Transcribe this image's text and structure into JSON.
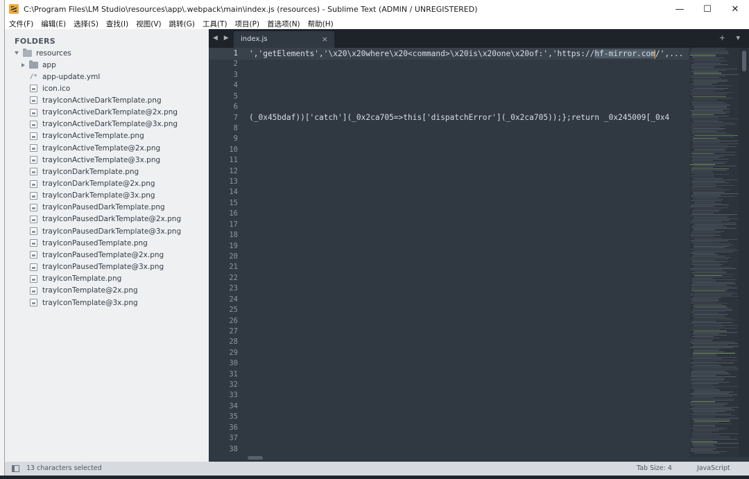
{
  "window": {
    "title": "C:\\Program Files\\LM Studio\\resources\\app\\.webpack\\main\\index.js (resources) - Sublime Text (ADMIN / UNREGISTERED)",
    "controls": {
      "minimize": "—",
      "maximize": "☐",
      "close": "✕"
    }
  },
  "menu": [
    "文件(F)",
    "编辑(E)",
    "选择(S)",
    "查找(I)",
    "视图(V)",
    "跳转(G)",
    "工具(T)",
    "项目(P)",
    "首选项(N)",
    "帮助(H)"
  ],
  "sidebar": {
    "header": "FOLDERS",
    "root": "resources",
    "items": [
      {
        "name": "app",
        "kind": "folder"
      },
      {
        "name": "app-update.yml",
        "kind": "code"
      },
      {
        "name": "icon.ico",
        "kind": "image"
      },
      {
        "name": "trayIconActiveDarkTemplate.png",
        "kind": "image"
      },
      {
        "name": "trayIconActiveDarkTemplate@2x.png",
        "kind": "image"
      },
      {
        "name": "trayIconActiveDarkTemplate@3x.png",
        "kind": "image"
      },
      {
        "name": "trayIconActiveTemplate.png",
        "kind": "image"
      },
      {
        "name": "trayIconActiveTemplate@2x.png",
        "kind": "image"
      },
      {
        "name": "trayIconActiveTemplate@3x.png",
        "kind": "image"
      },
      {
        "name": "trayIconDarkTemplate.png",
        "kind": "image"
      },
      {
        "name": "trayIconDarkTemplate@2x.png",
        "kind": "image"
      },
      {
        "name": "trayIconDarkTemplate@3x.png",
        "kind": "image"
      },
      {
        "name": "trayIconPausedDarkTemplate.png",
        "kind": "image"
      },
      {
        "name": "trayIconPausedDarkTemplate@2x.png",
        "kind": "image"
      },
      {
        "name": "trayIconPausedDarkTemplate@3x.png",
        "kind": "image"
      },
      {
        "name": "trayIconPausedTemplate.png",
        "kind": "image"
      },
      {
        "name": "trayIconPausedTemplate@2x.png",
        "kind": "image"
      },
      {
        "name": "trayIconPausedTemplate@3x.png",
        "kind": "image"
      },
      {
        "name": "trayIconTemplate.png",
        "kind": "image"
      },
      {
        "name": "trayIconTemplate@2x.png",
        "kind": "image"
      },
      {
        "name": "trayIconTemplate@3x.png",
        "kind": "image"
      }
    ]
  },
  "editor": {
    "tab": {
      "label": "index.js",
      "close": "×"
    },
    "nav": "◀ ▶",
    "tab_extra": "+ ▾",
    "line_count": 38,
    "active_line": 1,
    "lines": {
      "1": {
        "before": "','getElements','\\x20\\x20where\\x20<command>\\x20is\\x20one\\x20of:','https://",
        "selected": "hf-mirror.com",
        "after": "/',..."
      },
      "7": {
        "text": "(_0x45bdaf))['catch'](_0x2ca705=>this['dispatchError'](_0x2ca705));};return _0x245009[_0x4"
      }
    }
  },
  "status": {
    "selection": "13 characters selected",
    "tab_size": "Tab Size: 4",
    "syntax": "JavaScript"
  },
  "colors": {
    "editor_bg": "#303841",
    "sidebar_bg": "#eef0f2",
    "caret": "#f0a93b",
    "selection": "#4f5b66"
  }
}
